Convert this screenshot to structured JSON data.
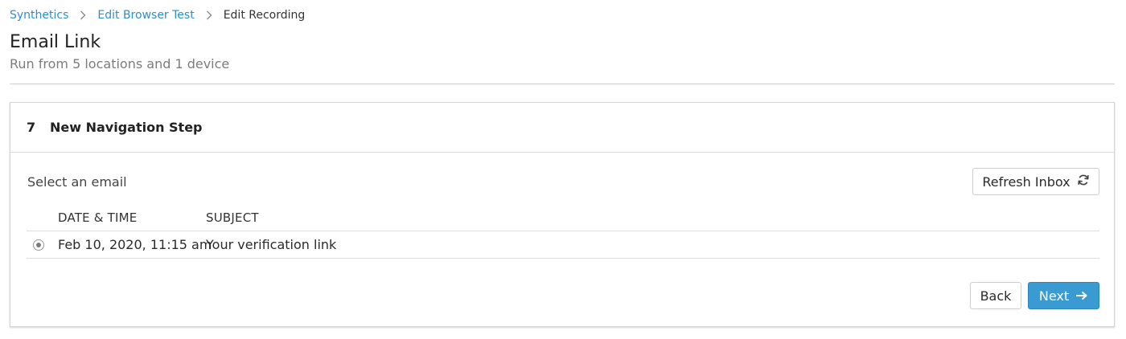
{
  "breadcrumb": {
    "items": [
      {
        "label": "Synthetics"
      },
      {
        "label": "Edit Browser Test"
      },
      {
        "label": "Edit Recording"
      }
    ]
  },
  "page": {
    "title": "Email Link",
    "subtitle": "Run from 5 locations and 1 device"
  },
  "step": {
    "number": "7",
    "title": "New Navigation Step"
  },
  "email_select": {
    "label": "Select an email",
    "refresh_label": "Refresh Inbox",
    "refresh_icon": "refresh-icon",
    "columns": [
      "DATE & TIME",
      "SUBJECT"
    ],
    "rows": [
      {
        "selected": true,
        "date_time": "Feb 10, 2020, 11:15 am",
        "subject": "Your verification link"
      }
    ]
  },
  "actions": {
    "back_label": "Back",
    "next_label": "Next",
    "next_icon": "arrow-right-icon",
    "primary_color": "#3a9bd3",
    "link_color": "#2f8fc7"
  }
}
